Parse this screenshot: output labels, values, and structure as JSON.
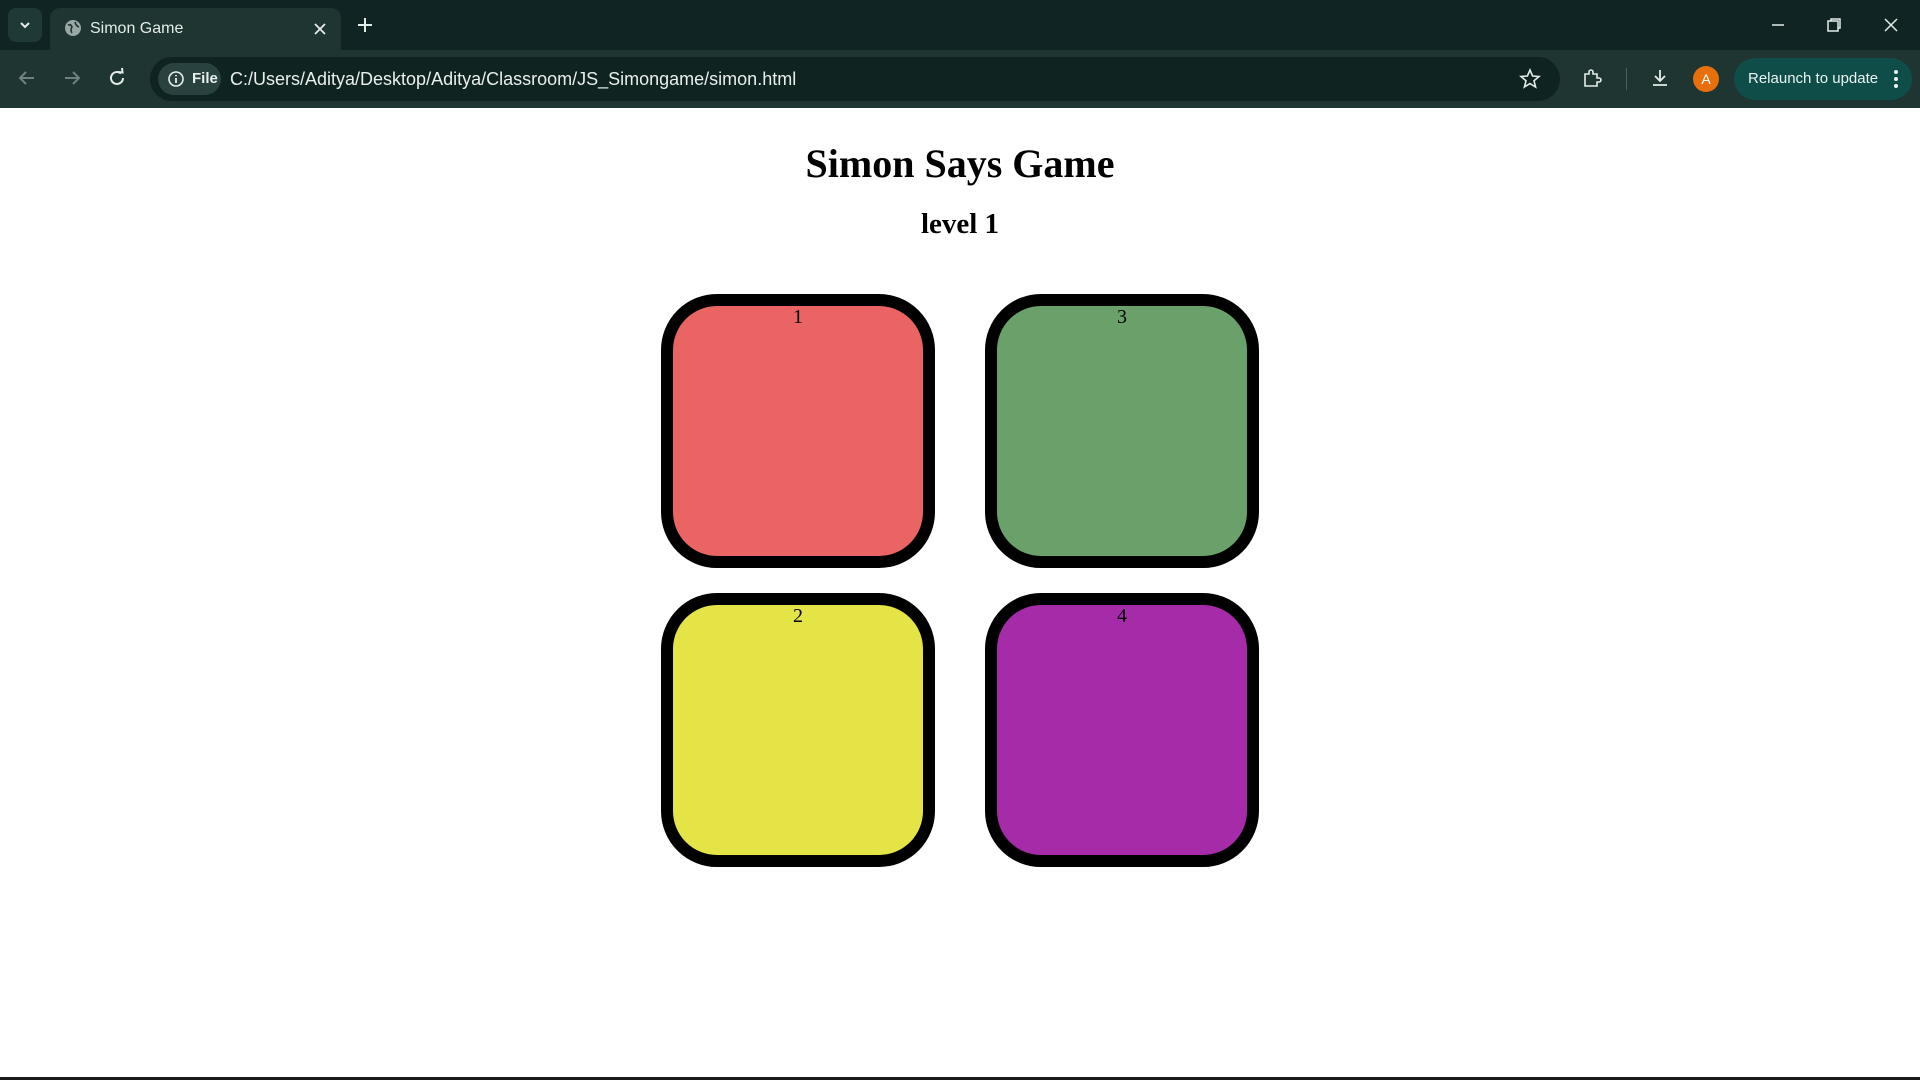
{
  "browser": {
    "tab_title": "Simon Game",
    "site_chip_label": "File",
    "url": "C:/Users/Aditya/Desktop/Aditya/Classroom/JS_Simongame/simon.html",
    "profile_initial": "A",
    "relaunch_label": "Relaunch to update"
  },
  "game": {
    "title": "Simon Says Game",
    "level_text": "level 1",
    "buttons": [
      {
        "label": "1",
        "color": "#ea6464"
      },
      {
        "label": "3",
        "color": "#6aa16a"
      },
      {
        "label": "2",
        "color": "#e5e446"
      },
      {
        "label": "4",
        "color": "#a62ba8"
      }
    ]
  }
}
